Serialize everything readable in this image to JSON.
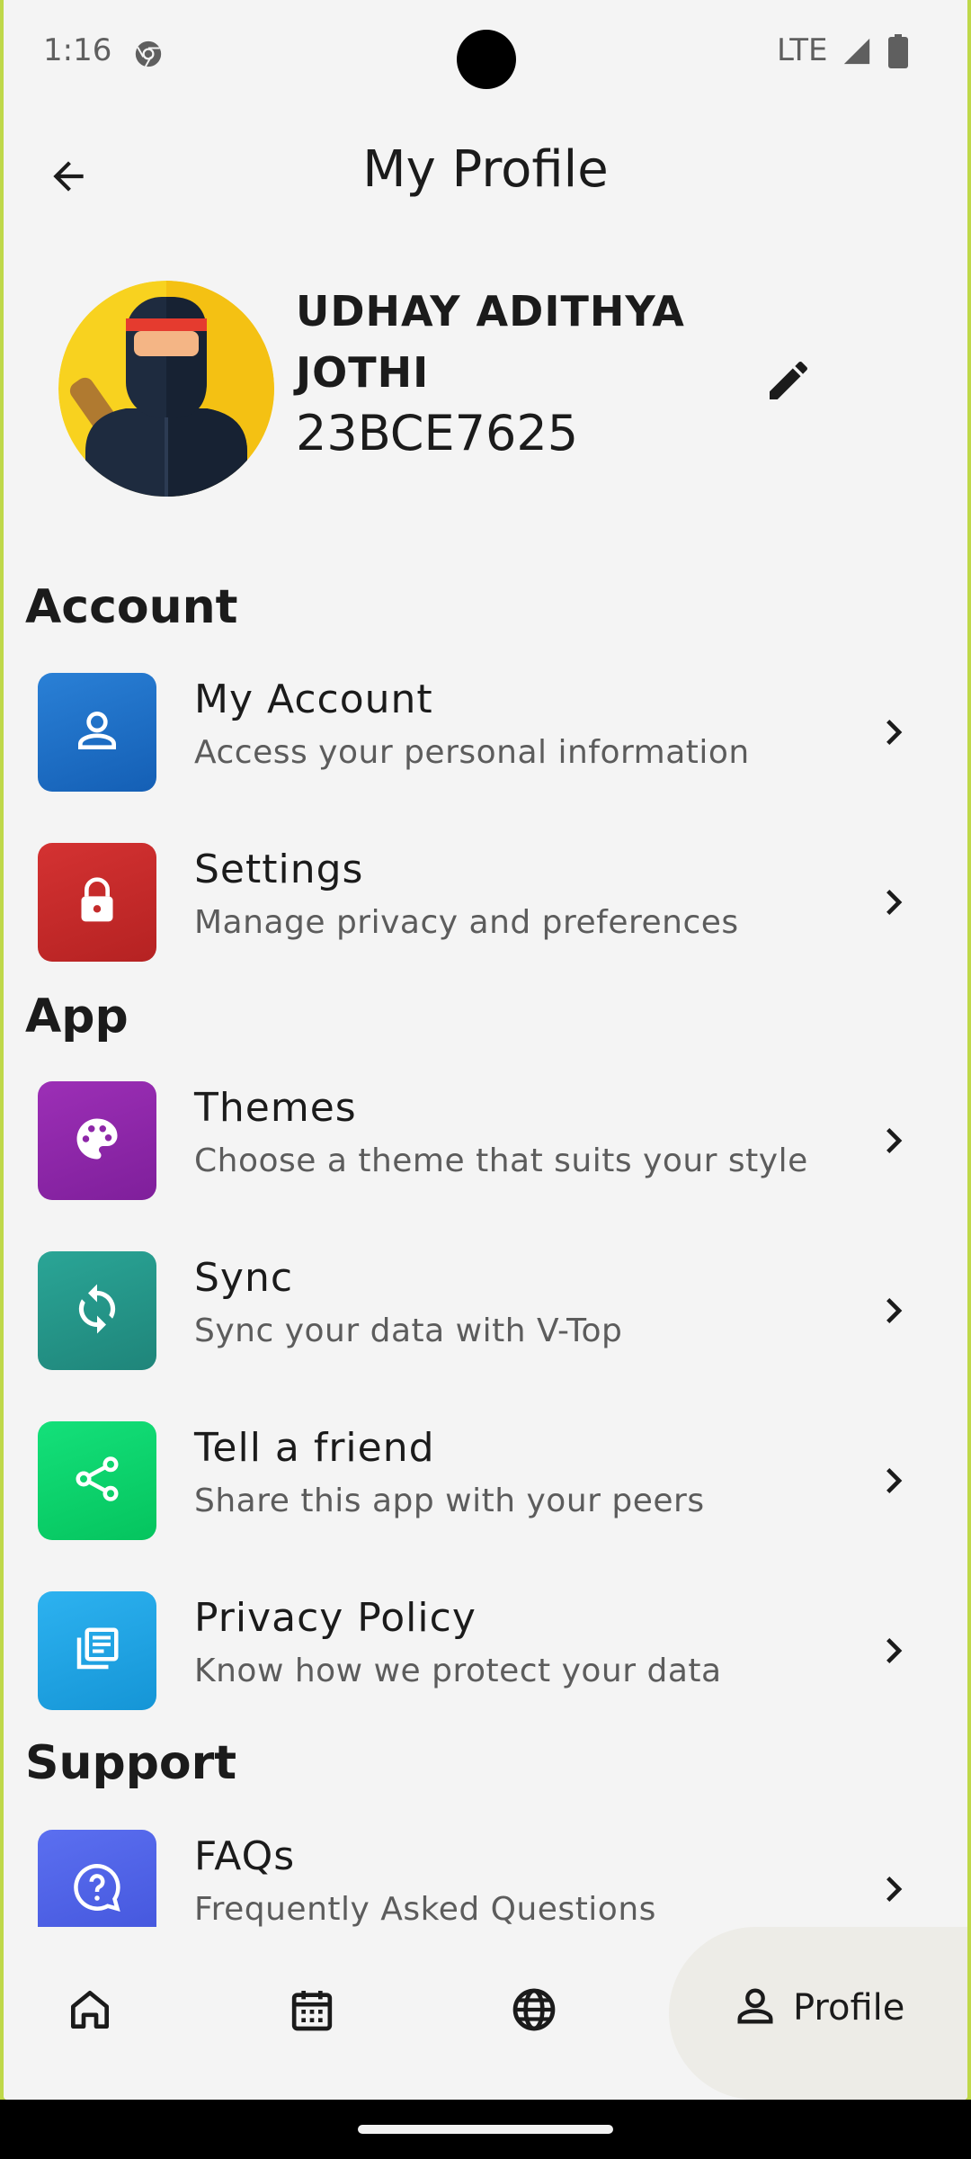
{
  "status_bar": {
    "time": "1:16",
    "network": "LTE"
  },
  "app_bar": {
    "title": "My Profile"
  },
  "profile": {
    "name": "UDHAY ADITHYA JOTHI",
    "reg_no": "23BCE7625"
  },
  "sections": {
    "account": {
      "title": "Account",
      "items": [
        {
          "title": "My Account",
          "subtitle": "Access your personal information",
          "icon": "person-icon",
          "color": "#1f72c8"
        },
        {
          "title": "Settings",
          "subtitle": "Manage privacy and preferences",
          "icon": "lock-icon",
          "color": "#c42b2b"
        }
      ]
    },
    "app": {
      "title": "App",
      "items": [
        {
          "title": "Themes",
          "subtitle": "Choose a theme that suits your style",
          "icon": "palette-icon",
          "color": "#8e27a8"
        },
        {
          "title": "Sync",
          "subtitle": "Sync your data with V-Top",
          "icon": "sync-icon",
          "color": "#26968a"
        },
        {
          "title": "Tell a friend",
          "subtitle": "Share this app with your peers",
          "icon": "share-icon",
          "color": "#0ed36a"
        },
        {
          "title": "Privacy Policy",
          "subtitle": "Know how we protect your data",
          "icon": "policy-icon",
          "color": "#1ea6e8"
        }
      ]
    },
    "support": {
      "title": "Support",
      "items": [
        {
          "title": "FAQs",
          "subtitle": "Frequently Asked Questions",
          "icon": "help-icon",
          "color": "#4f63e6"
        }
      ]
    }
  },
  "bottom_nav": {
    "items": [
      {
        "icon": "home-icon"
      },
      {
        "icon": "calendar-icon"
      },
      {
        "icon": "globe-icon"
      },
      {
        "icon": "profile-icon",
        "label": "Profile",
        "selected": true
      }
    ]
  }
}
